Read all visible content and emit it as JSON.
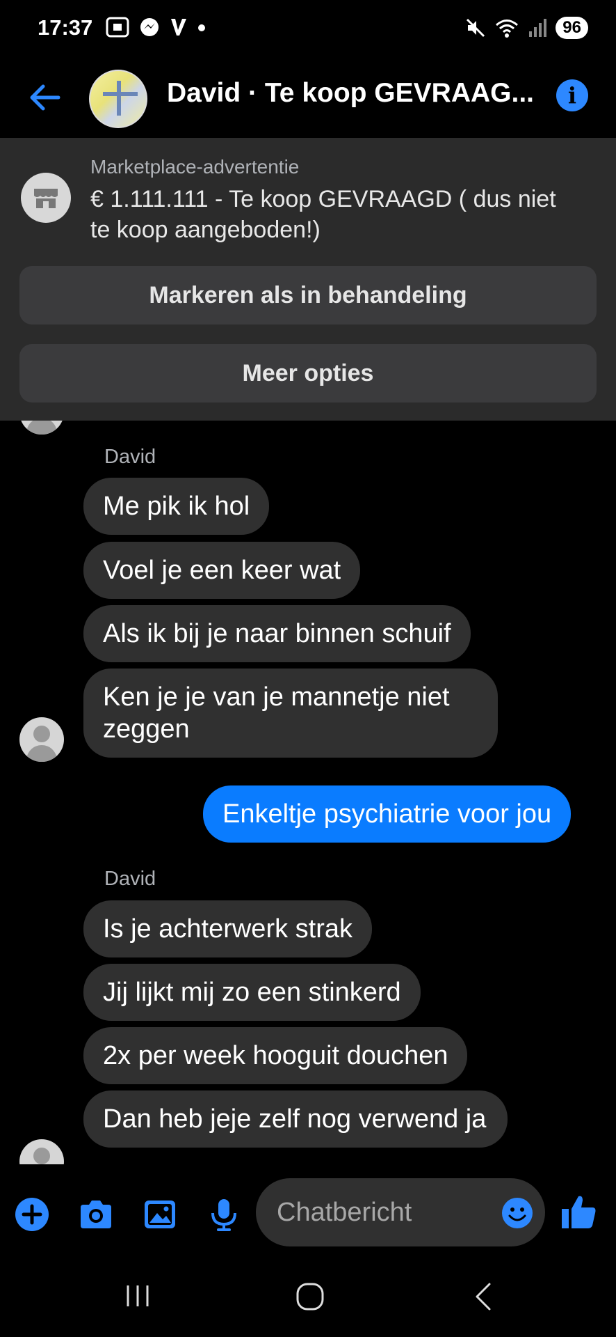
{
  "status_bar": {
    "time": "17:37",
    "battery": "96",
    "left_icons": [
      "screenshot-icon",
      "messenger-icon",
      "v-app-icon",
      "dot-icon"
    ],
    "right_icons": [
      "mute-icon",
      "wifi-icon",
      "signal-icon"
    ]
  },
  "header": {
    "title": "David · Te koop GEVRAAG...",
    "back_icon": "arrow-left-icon",
    "info_icon": "info-icon"
  },
  "marketplace": {
    "label": "Marketplace-advertentie",
    "title": "€ 1.111.111 - Te koop GEVRAAGD ( dus niet te koop aangeboden!)",
    "buttons": [
      "Markeren als in behandeling",
      "Meer opties"
    ]
  },
  "chat": {
    "groups": [
      {
        "sender": "David",
        "messages": [
          "Me pik ik hol",
          "Voel je een keer wat",
          "Als ik bij je naar binnen schuif",
          "Ken je je van je mannetje niet zeggen"
        ]
      },
      {
        "sender": "me",
        "messages": [
          "Enkeltje psychiatrie voor jou"
        ]
      },
      {
        "sender": "David",
        "messages": [
          "Is je achterwerk strak",
          "Jij lijkt mij zo een stinkerd",
          "2x per week hooguit douchen",
          "Dan heb jeje zelf nog verwend ja"
        ]
      }
    ]
  },
  "composer": {
    "placeholder": "Chatbericht"
  },
  "colors": {
    "accent": "#0a7cff",
    "bubble_in": "#303030",
    "panel": "#2b2b2b"
  }
}
